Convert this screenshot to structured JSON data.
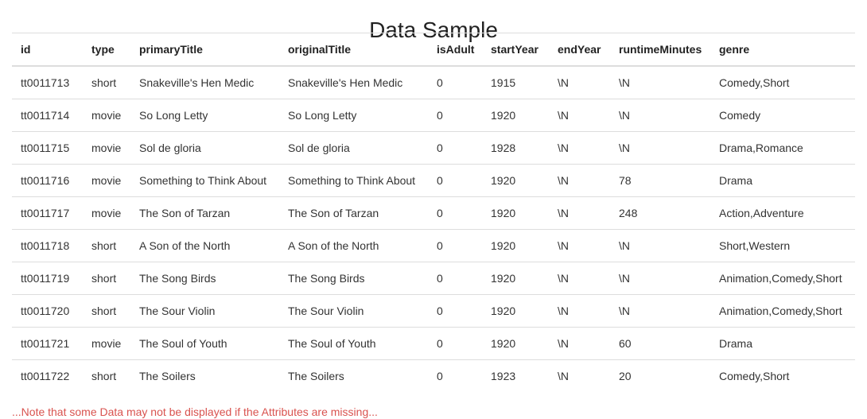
{
  "title": "Data Sample",
  "columns": [
    "id",
    "type",
    "primaryTitle",
    "originalTitle",
    "isAdult",
    "startYear",
    "endYear",
    "runtimeMinutes",
    "genre"
  ],
  "rows": [
    [
      "tt0011713",
      "short",
      "Snakeville's Hen Medic",
      "Snakeville's Hen Medic",
      "0",
      "1915",
      "\\N",
      "\\N",
      "Comedy,Short"
    ],
    [
      "tt0011714",
      "movie",
      "So Long Letty",
      "So Long Letty",
      "0",
      "1920",
      "\\N",
      "\\N",
      "Comedy"
    ],
    [
      "tt0011715",
      "movie",
      "Sol de gloria",
      "Sol de gloria",
      "0",
      "1928",
      "\\N",
      "\\N",
      "Drama,Romance"
    ],
    [
      "tt0011716",
      "movie",
      "Something to Think About",
      "Something to Think About",
      "0",
      "1920",
      "\\N",
      "78",
      "Drama"
    ],
    [
      "tt0011717",
      "movie",
      "The Son of Tarzan",
      "The Son of Tarzan",
      "0",
      "1920",
      "\\N",
      "248",
      "Action,Adventure"
    ],
    [
      "tt0011718",
      "short",
      "A Son of the North",
      "A Son of the North",
      "0",
      "1920",
      "\\N",
      "\\N",
      "Short,Western"
    ],
    [
      "tt0011719",
      "short",
      "The Song Birds",
      "The Song Birds",
      "0",
      "1920",
      "\\N",
      "\\N",
      "Animation,Comedy,Short"
    ],
    [
      "tt0011720",
      "short",
      "The Sour Violin",
      "The Sour Violin",
      "0",
      "1920",
      "\\N",
      "\\N",
      "Animation,Comedy,Short"
    ],
    [
      "tt0011721",
      "movie",
      "The Soul of Youth",
      "The Soul of Youth",
      "0",
      "1920",
      "\\N",
      "60",
      "Drama"
    ],
    [
      "tt0011722",
      "short",
      "The Soilers",
      "The Soilers",
      "0",
      "1923",
      "\\N",
      "20",
      "Comedy,Short"
    ]
  ],
  "note": "...Note that some Data may not be displayed if the Attributes are missing...",
  "colors": {
    "note": "#d9534f",
    "border": "#dddddd",
    "text": "#333333"
  }
}
